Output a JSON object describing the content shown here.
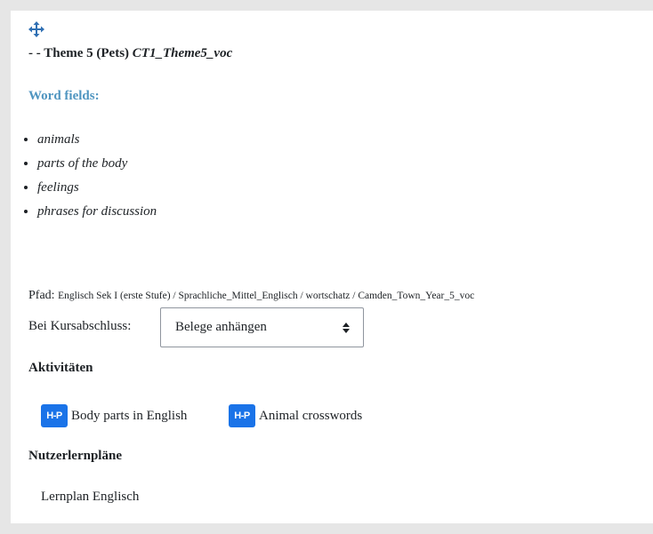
{
  "section": {
    "title_prefix": "- - Theme 5 (Pets) ",
    "title_code": "CT1_Theme5_voc",
    "word_fields_heading": "Word fields:",
    "word_fields": [
      "animals",
      "parts of the body",
      "feelings",
      "phrases for discussion"
    ]
  },
  "path": {
    "label": "Pfad: ",
    "value": "Englisch Sek I (erste Stufe) / Sprachliche_Mittel_Englisch / wortschatz / Camden_Town_Year_5_voc"
  },
  "completion": {
    "label": "Bei Kursabschluss:",
    "selected": "Belege anhängen"
  },
  "activities": {
    "heading": "Aktivitäten",
    "items": [
      {
        "icon": "h5p-icon",
        "badge": "H-P",
        "label": "Body parts in English"
      },
      {
        "icon": "h5p-icon",
        "badge": "H-P",
        "label": "Animal crosswords"
      }
    ]
  },
  "plans": {
    "heading": "Nutzerlernpläne",
    "items": [
      "Lernplan Englisch"
    ]
  },
  "colors": {
    "accent": "#4f95c0",
    "move_icon": "#2f6fb3",
    "h5p_badge": "#1a73e8"
  }
}
